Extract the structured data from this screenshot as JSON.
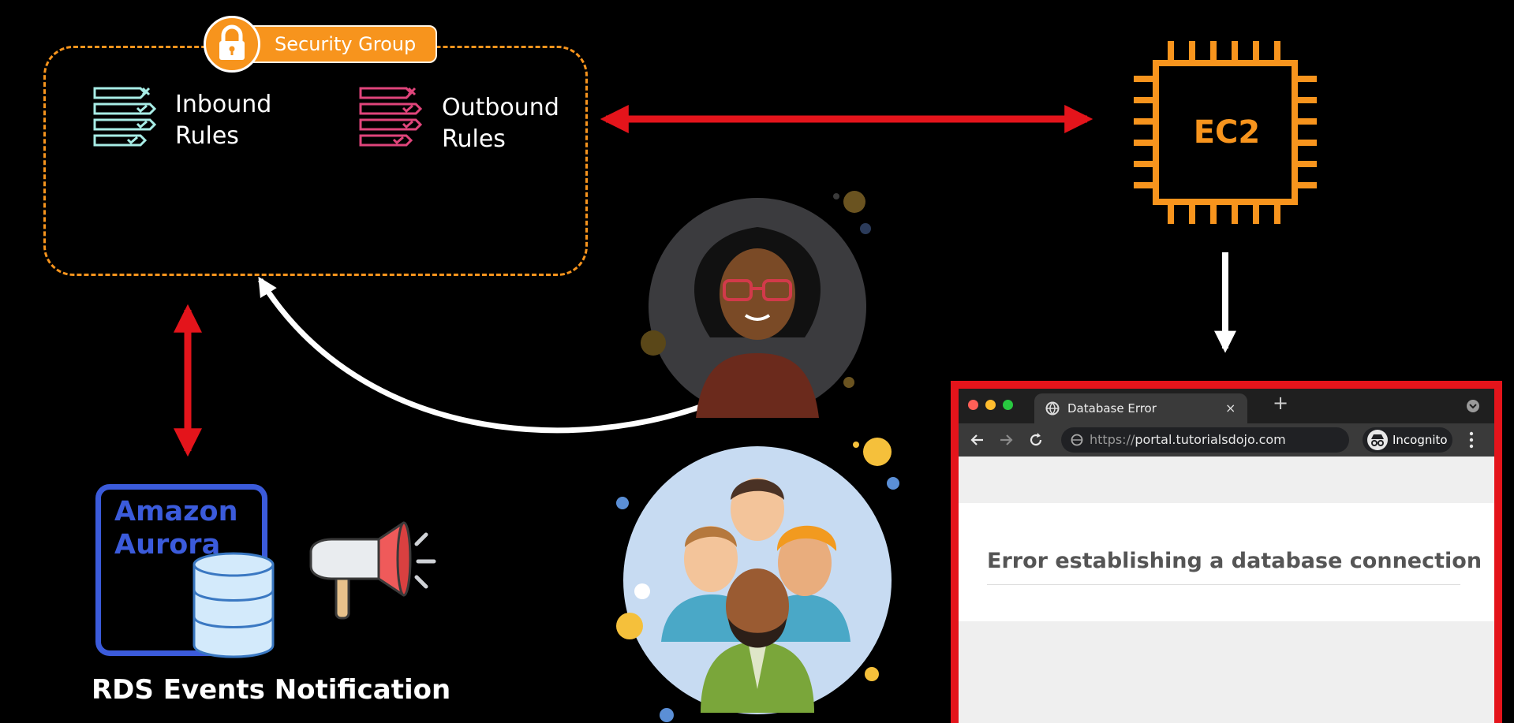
{
  "security_group": {
    "label": "Security Group",
    "inbound_line1": "Inbound",
    "inbound_line2": "Rules",
    "outbound_line1": "Outbound",
    "outbound_line2": "Rules"
  },
  "ec2": {
    "label": "EC2"
  },
  "aurora": {
    "line1": "Amazon",
    "line2": "Aurora"
  },
  "rds": {
    "label": "RDS Events Notification"
  },
  "browser": {
    "tab_title": "Database Error",
    "tab_close": "×",
    "new_tab": "+",
    "url_prefix": "https://",
    "url_host": "portal.tutorialsdojo.com",
    "incognito": "Incognito",
    "error_message": "Error establishing a database connection"
  },
  "colors": {
    "orange": "#f7941d",
    "red": "#e4141b",
    "aurora_blue": "#3b5bdb",
    "inbound_teal": "#a8ede6",
    "outbound_pink": "#e0457b"
  },
  "icons": [
    "lock-icon",
    "inbound-rules-icon",
    "outbound-rules-icon",
    "ec2-chip-icon",
    "database-icon",
    "megaphone-icon",
    "developer-avatar-icon",
    "users-group-icon",
    "globe-icon",
    "back-icon",
    "forward-icon",
    "reload-icon",
    "incognito-icon",
    "menu-dots-icon"
  ]
}
